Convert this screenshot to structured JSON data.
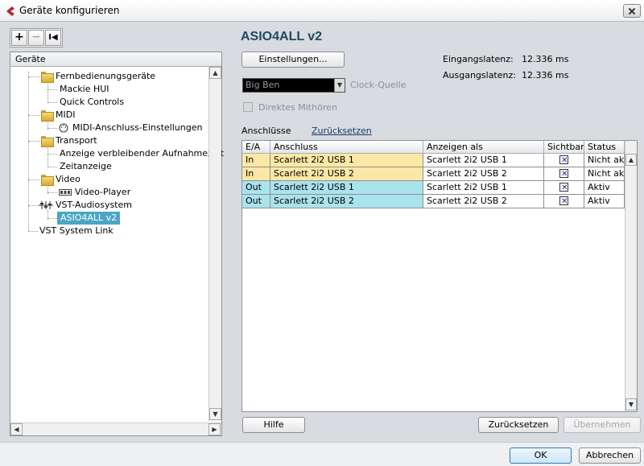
{
  "window": {
    "title": "Geräte konfigurieren"
  },
  "toolbar": {
    "add_label": "+",
    "remove_label": "−",
    "reset_label": "I◀"
  },
  "tree": {
    "header": "Geräte",
    "items": [
      {
        "label": "Fernbedienungsgeräte",
        "level": 0
      },
      {
        "label": "Mackie HUI",
        "level": 1
      },
      {
        "label": "Quick Controls",
        "level": 1
      },
      {
        "label": "MIDI",
        "level": 0
      },
      {
        "label": "MIDI-Anschluss-Einstellungen",
        "level": 1
      },
      {
        "label": "Transport",
        "level": 0
      },
      {
        "label": "Anzeige verbleibender Aufnahmezeit",
        "level": 1
      },
      {
        "label": "Zeitanzeige",
        "level": 1
      },
      {
        "label": "Video",
        "level": 0
      },
      {
        "label": "Video-Player",
        "level": 1
      },
      {
        "label": "VST-Audiosystem",
        "level": 0
      },
      {
        "label": "ASIO4ALL v2",
        "level": 1,
        "selected": true
      },
      {
        "label": "VST System Link",
        "level": 0
      }
    ]
  },
  "main": {
    "title": "ASIO4ALL v2",
    "settings_button": "Einstellungen...",
    "input_latency_label": "Eingangslatenz:",
    "input_latency_value": "12.336 ms",
    "output_latency_label": "Ausgangslatenz:",
    "output_latency_value": "12.336 ms",
    "clock_source_value": "Big Ben",
    "clock_source_label": "Clock-Quelle",
    "direct_monitoring_label": "Direktes Mithören",
    "ports_label": "Anschlüsse",
    "reset_link": "Zurücksetzen",
    "table": {
      "columns": [
        "E/A",
        "Anschluss",
        "Anzeigen als",
        "Sichtbar",
        "Status"
      ],
      "rows": [
        {
          "io": "In",
          "port": "Scarlett 2i2 USB 1",
          "show_as": "Scarlett 2i2 USB 1",
          "visible": true,
          "status": "Nicht aktiv"
        },
        {
          "io": "In",
          "port": "Scarlett 2i2 USB 2",
          "show_as": "Scarlett 2i2 USB 2",
          "visible": true,
          "status": "Nicht aktiv"
        },
        {
          "io": "Out",
          "port": "Scarlett 2i2 USB 1",
          "show_as": "Scarlett 2i2 USB 1",
          "visible": true,
          "status": "Aktiv"
        },
        {
          "io": "Out",
          "port": "Scarlett 2i2 USB 2",
          "show_as": "Scarlett 2i2 USB 2",
          "visible": true,
          "status": "Aktiv"
        }
      ]
    },
    "help_button": "Hilfe",
    "reset_button": "Zurücksetzen",
    "apply_button": "Übernehmen"
  },
  "footer": {
    "ok_button": "OK",
    "cancel_button": "Abbrechen"
  },
  "colors": {
    "in_row": "#fbe8a6",
    "out_row": "#a9e3ee",
    "selection": "#4ba6c5",
    "title": "#1c4a63"
  }
}
